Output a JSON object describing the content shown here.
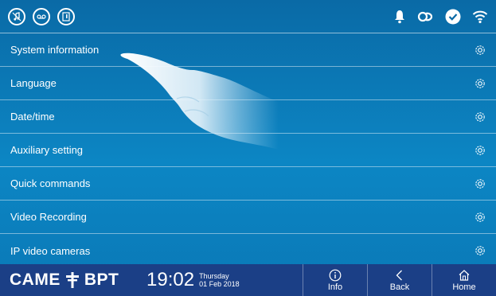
{
  "status_bar": {
    "left_icons": [
      "music-mute-icon",
      "voicemail-icon",
      "door-status-icon"
    ],
    "right_icons": [
      "bell-icon",
      "link-icon",
      "check-icon",
      "wifi-icon"
    ]
  },
  "menu": {
    "items": [
      {
        "label": "System information"
      },
      {
        "label": "Language"
      },
      {
        "label": "Date/time"
      },
      {
        "label": "Auxiliary setting"
      },
      {
        "label": "Quick commands"
      },
      {
        "label": "Video Recording"
      },
      {
        "label": "IP video cameras"
      }
    ]
  },
  "footer": {
    "brand": "CAME",
    "brand_suffix": "BPT",
    "time": "19:02",
    "day": "Thursday",
    "date": "01 Feb 2018",
    "buttons": {
      "info": "Info",
      "back": "Back",
      "home": "Home"
    }
  },
  "colors": {
    "background": "#0c86c4",
    "footer": "#1b3f86"
  }
}
